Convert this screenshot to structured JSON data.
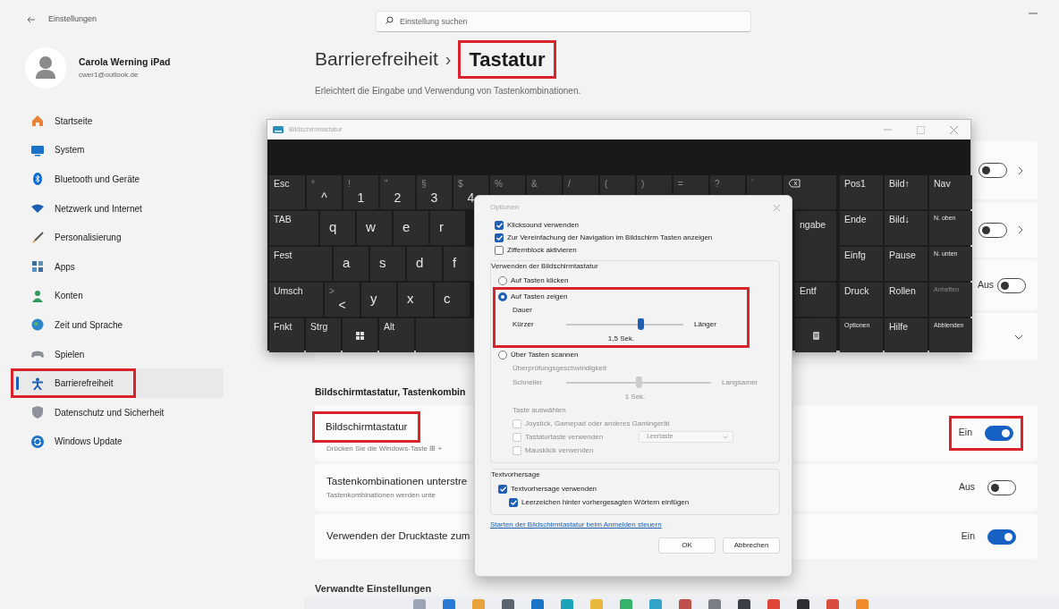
{
  "window": {
    "title": "Einstellungen"
  },
  "search": {
    "placeholder": "Einstellung suchen"
  },
  "profile": {
    "name": "Carola Werning iPad",
    "email": "cwer1@outlook.de"
  },
  "sidebar": {
    "items": [
      {
        "kind": "home",
        "label": "Startseite",
        "selected": false,
        "highlighted": false
      },
      {
        "kind": "system",
        "label": "System",
        "selected": false,
        "highlighted": false
      },
      {
        "kind": "bluetooth",
        "label": "Bluetooth und Geräte",
        "selected": false,
        "highlighted": false
      },
      {
        "kind": "network",
        "label": "Netzwerk und Internet",
        "selected": false,
        "highlighted": false
      },
      {
        "kind": "brush",
        "label": "Personalisierung",
        "selected": false,
        "highlighted": false
      },
      {
        "kind": "apps",
        "label": "Apps",
        "selected": false,
        "highlighted": false
      },
      {
        "kind": "accounts",
        "label": "Konten",
        "selected": false,
        "highlighted": false
      },
      {
        "kind": "time",
        "label": "Zeit und Sprache",
        "selected": false,
        "highlighted": false
      },
      {
        "kind": "gaming",
        "label": "Spielen",
        "selected": false,
        "highlighted": false
      },
      {
        "kind": "accessibility",
        "label": "Barrierefreiheit",
        "selected": true,
        "highlighted": true
      },
      {
        "kind": "privacy",
        "label": "Datenschutz und Sicherheit",
        "selected": false,
        "highlighted": false
      },
      {
        "kind": "update",
        "label": "Windows Update",
        "selected": false,
        "highlighted": false
      }
    ]
  },
  "breadcrumb": {
    "parent": "Barrierefreiheit",
    "separator": "›",
    "current": "Tastatur",
    "highlighted": true
  },
  "subtitle": "Erleichtert die Eingabe und Verwendung von Tastenkombinationen.",
  "upper_rows": [
    {
      "kind": "toggle-link",
      "on": false
    },
    {
      "kind": "toggle-link",
      "on": false
    },
    {
      "kind": "toggle",
      "state_text": "Aus",
      "on": false
    },
    {
      "kind": "expander"
    }
  ],
  "section": {
    "title": "Bildschirmtastatur, Tastenkombin",
    "rows": [
      {
        "title": "Bildschirmtastatur",
        "description": "Drücken Sie die Windows-Taste ⊞ +",
        "title_highlighted": true,
        "state_text": "Ein",
        "on": true,
        "toggle_highlighted": true
      },
      {
        "title": "Tastenkombinationen unterstre",
        "description": "Tastenkombinationen werden unte",
        "title_highlighted": false,
        "state_text": "Aus",
        "on": false,
        "toggle_highlighted": false
      },
      {
        "title": "Verwenden der Drucktaste zum",
        "title_highlighted": false,
        "state_text": "Ein",
        "on": true,
        "toggle_highlighted": false
      }
    ]
  },
  "related": {
    "title": "Verwandte Einstellungen"
  },
  "keyboard_window": {
    "title": "Bildschirmtastatur",
    "rows": [
      [
        {
          "kind": "function",
          "label": "Esc"
        },
        {
          "kind": "symbol",
          "label": "^",
          "shift": "°"
        },
        {
          "kind": "symbol",
          "label": "1",
          "shift": "!"
        },
        {
          "kind": "symbol",
          "label": "2",
          "shift": "\""
        },
        {
          "kind": "symbol",
          "label": "3",
          "shift": "§"
        },
        {
          "kind": "symbol",
          "label": "4",
          "shift": "$"
        },
        {
          "kind": "symbol",
          "shift": "%"
        },
        {
          "kind": "symbol",
          "shift": "&"
        },
        {
          "kind": "symbol",
          "shift": "/"
        },
        {
          "kind": "symbol",
          "shift": "("
        },
        {
          "kind": "symbol",
          "shift": ")"
        },
        {
          "kind": "symbol",
          "shift": "="
        },
        {
          "kind": "symbol",
          "shift": "?"
        },
        {
          "kind": "symbol",
          "shift": "`"
        },
        {
          "kind": "backspace"
        }
      ],
      [
        {
          "kind": "function",
          "label": "TAB"
        },
        {
          "kind": "letter",
          "label": "q"
        },
        {
          "kind": "letter",
          "label": "w"
        },
        {
          "kind": "letter",
          "label": "e"
        },
        {
          "kind": "letter",
          "label": "r"
        }
      ],
      [
        {
          "kind": "function",
          "label": "Fest"
        },
        {
          "kind": "letter",
          "label": "a"
        },
        {
          "kind": "letter",
          "label": "s"
        },
        {
          "kind": "letter",
          "label": "d"
        },
        {
          "kind": "letter",
          "label": "f"
        }
      ],
      [
        {
          "kind": "function",
          "label": "Umsch"
        },
        {
          "kind": "symbol",
          "label": "<",
          "shift": ">"
        },
        {
          "kind": "letter",
          "label": "y"
        },
        {
          "kind": "letter",
          "label": "x"
        },
        {
          "kind": "letter",
          "label": "c"
        }
      ],
      [
        {
          "kind": "function",
          "label": "Fnkt"
        },
        {
          "kind": "function",
          "label": "Strg"
        },
        {
          "kind": "windows"
        },
        {
          "kind": "function",
          "label": "Alt"
        },
        {
          "kind": "space"
        }
      ]
    ],
    "edge_keys": [
      {
        "kind": "enter",
        "label": "ngabe"
      },
      {
        "kind": "function",
        "label": "Entf"
      },
      {
        "kind": "icon"
      }
    ],
    "nav_keys": [
      {
        "kind": "function",
        "label": "Pos1",
        "disabled": false
      },
      {
        "kind": "function",
        "label": "Bild↑",
        "disabled": false
      },
      {
        "kind": "function",
        "label": "Nav",
        "disabled": false
      },
      {
        "kind": "function",
        "label": "Ende",
        "disabled": false
      },
      {
        "kind": "function",
        "label": "Bild↓",
        "disabled": false
      },
      {
        "kind": "small",
        "label": "N. oben",
        "disabled": false
      },
      {
        "kind": "function",
        "label": "Einfg",
        "disabled": false
      },
      {
        "kind": "function",
        "label": "Pause",
        "disabled": false
      },
      {
        "kind": "small",
        "label": "N. unten",
        "disabled": false
      },
      {
        "kind": "function",
        "label": "Druck",
        "disabled": false
      },
      {
        "kind": "function",
        "label": "Rollen",
        "disabled": false
      },
      {
        "kind": "small",
        "label": "Anheften",
        "disabled": true
      },
      {
        "kind": "small",
        "label": "Optionen",
        "disabled": false
      },
      {
        "kind": "function",
        "label": "Hilfe",
        "disabled": false
      },
      {
        "kind": "small",
        "label": "Abblenden",
        "disabled": false
      }
    ]
  },
  "options_dialog": {
    "title": "Optionen",
    "options": [
      {
        "label": "Klicksound verwenden",
        "checked": true
      },
      {
        "label": "Zur Vereinfachung der Navigation im Bildschirm Tasten anzeigen",
        "checked": true
      },
      {
        "label": "Ziffernblock aktivieren",
        "checked": false
      }
    ],
    "usage_group": {
      "title": "Verwenden der Bildschirmtastatur",
      "items": [
        {
          "kind": "radio",
          "label": "Auf Tasten klicken",
          "selected": false,
          "disabled": false,
          "highlighted": false
        },
        {
          "kind": "radio",
          "label": "Auf Tasten zeigen",
          "selected": true,
          "disabled": false,
          "highlighted": true
        },
        {
          "kind": "caption",
          "label": "Dauer",
          "disabled": false,
          "highlighted": true
        },
        {
          "kind": "slider",
          "min_label": "Kürzer",
          "max_label": "Länger",
          "level": 0.63,
          "reading": "1,5 Sek.",
          "disabled": false,
          "highlighted": true
        },
        {
          "kind": "radio",
          "label": "Über Tasten scannen",
          "selected": false,
          "disabled": false,
          "highlighted": false
        },
        {
          "kind": "caption",
          "label": "Überprüfungsgeschwindigkeit",
          "disabled": true,
          "highlighted": false
        },
        {
          "kind": "slider",
          "min_label": "Schneller",
          "max_label": "Langsamer",
          "level": 0.5,
          "reading": "1 Sek.",
          "disabled": true,
          "highlighted": false
        },
        {
          "kind": "caption",
          "label": "Taste auswählen",
          "disabled": true,
          "highlighted": false
        },
        {
          "kind": "checkbox",
          "label": "Joystick, Gamepad oder anderes Gamingerät",
          "checked": false,
          "disabled": true,
          "highlighted": false
        },
        {
          "kind": "checkbox",
          "label": "Tastaturtaste verwenden",
          "checked": false,
          "disabled": true,
          "highlighted": false,
          "dropdown": "Leertaste"
        },
        {
          "kind": "checkbox",
          "label": "Mausklick verwenden",
          "checked": false,
          "disabled": true,
          "highlighted": false
        }
      ]
    },
    "prediction_group": {
      "title": "Textvorhersage",
      "items": [
        {
          "label": "Textvorhersage verwenden",
          "checked": true,
          "children": [
            {
              "label": "Leerzeichen hinter vorhergesagten Wörtern einfügen",
              "checked": true
            }
          ]
        }
      ]
    },
    "link": "Starten der Bildschirmtastatur beim Anmelden steuern",
    "buttons": [
      {
        "label": "OK"
      },
      {
        "label": "Abbrechen"
      }
    ]
  },
  "taskbar": {
    "apps": [
      {
        "color": "#9aa4b2"
      },
      {
        "color": "#2b7bd6"
      },
      {
        "color": "#e8a33c"
      },
      {
        "color": "#5c6470"
      },
      {
        "color": "#1a73c9"
      },
      {
        "color": "#1aa3b8"
      },
      {
        "color": "#e8b83c"
      },
      {
        "color": "#36b36a"
      },
      {
        "color": "#2fa3c8"
      },
      {
        "color": "#c0504d"
      },
      {
        "color": "#7a7f88"
      },
      {
        "color": "#3a3f47"
      },
      {
        "color": "#e0453a"
      },
      {
        "color": "#2d2f33"
      },
      {
        "color": "#d94c3f"
      },
      {
        "color": "#f08a2a"
      }
    ]
  }
}
